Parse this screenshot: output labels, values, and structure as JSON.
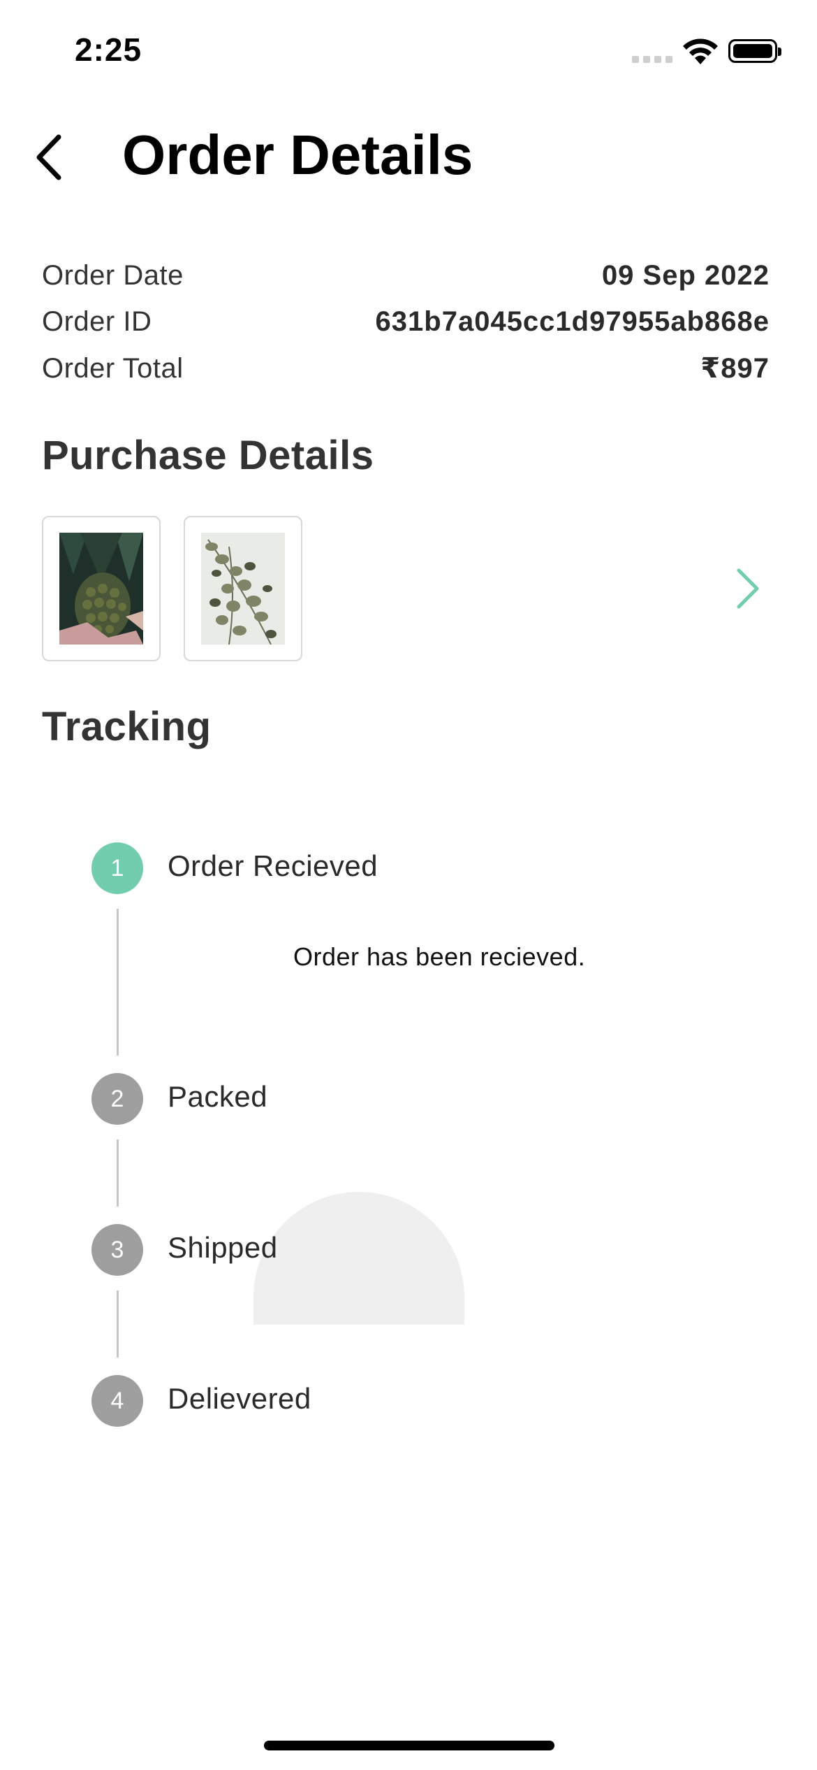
{
  "status_bar": {
    "time": "2:25"
  },
  "header": {
    "title": "Order Details",
    "back_icon": "chevron-left-icon"
  },
  "order_info": [
    {
      "label": "Order Date",
      "value": "09 Sep 2022"
    },
    {
      "label": "Order ID",
      "value": "631b7a045cc1d97955ab868e"
    },
    {
      "label": "Order Total",
      "value": "₹897"
    }
  ],
  "purchase": {
    "title": "Purchase Details",
    "items": [
      {
        "image": "pineapple-photo"
      },
      {
        "image": "eucalyptus-photo"
      }
    ],
    "more_icon": "chevron-right-icon"
  },
  "tracking": {
    "title": "Tracking",
    "steps": [
      {
        "number": "1",
        "label": "Order Recieved",
        "status": "active",
        "description": "Order has been recieved."
      },
      {
        "number": "2",
        "label": "Packed",
        "status": "inactive"
      },
      {
        "number": "3",
        "label": "Shipped",
        "status": "inactive"
      },
      {
        "number": "4",
        "label": "Delievered",
        "status": "inactive"
      }
    ]
  },
  "colors": {
    "accent": "#72cdae",
    "inactive_step": "#9e9e9e",
    "text": "#2a2a2a"
  }
}
